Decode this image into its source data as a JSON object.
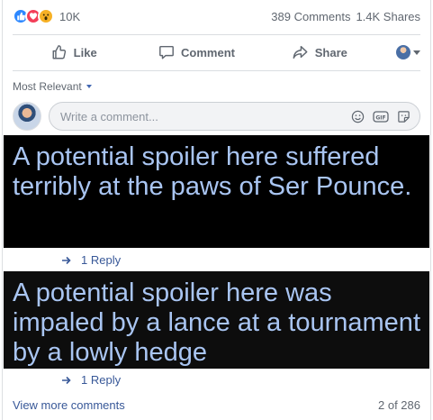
{
  "reactions": {
    "icons": [
      "like-icon",
      "love-icon",
      "wow-icon"
    ],
    "count": "10K",
    "comments": "389 Comments",
    "shares": "1.4K Shares"
  },
  "actions": {
    "like": "Like",
    "comment": "Comment",
    "share": "Share"
  },
  "sort": {
    "label": "Most Relevant"
  },
  "composer": {
    "placeholder": "Write a comment...",
    "icons": [
      "emoji-icon",
      "gif-icon",
      "sticker-icon"
    ]
  },
  "comments": [
    {
      "spoiler_text": "A potential spoiler here suffered terribly at the paws of Ser Pounce.",
      "reply_label": "1 Reply"
    },
    {
      "spoiler_text": "A potential spoiler here was impaled by a lance at a tournament by a lowly hedge",
      "reply_label": "1 Reply"
    }
  ],
  "footer": {
    "view_more": "View more comments",
    "pager": "2 of 286"
  },
  "colors": {
    "link": "#385898",
    "spoiler_bg": "#000000",
    "spoiler_text": "#a9c5f2",
    "like": "#2d88ff",
    "love": "#f33e58",
    "wow": "#f7b125"
  }
}
